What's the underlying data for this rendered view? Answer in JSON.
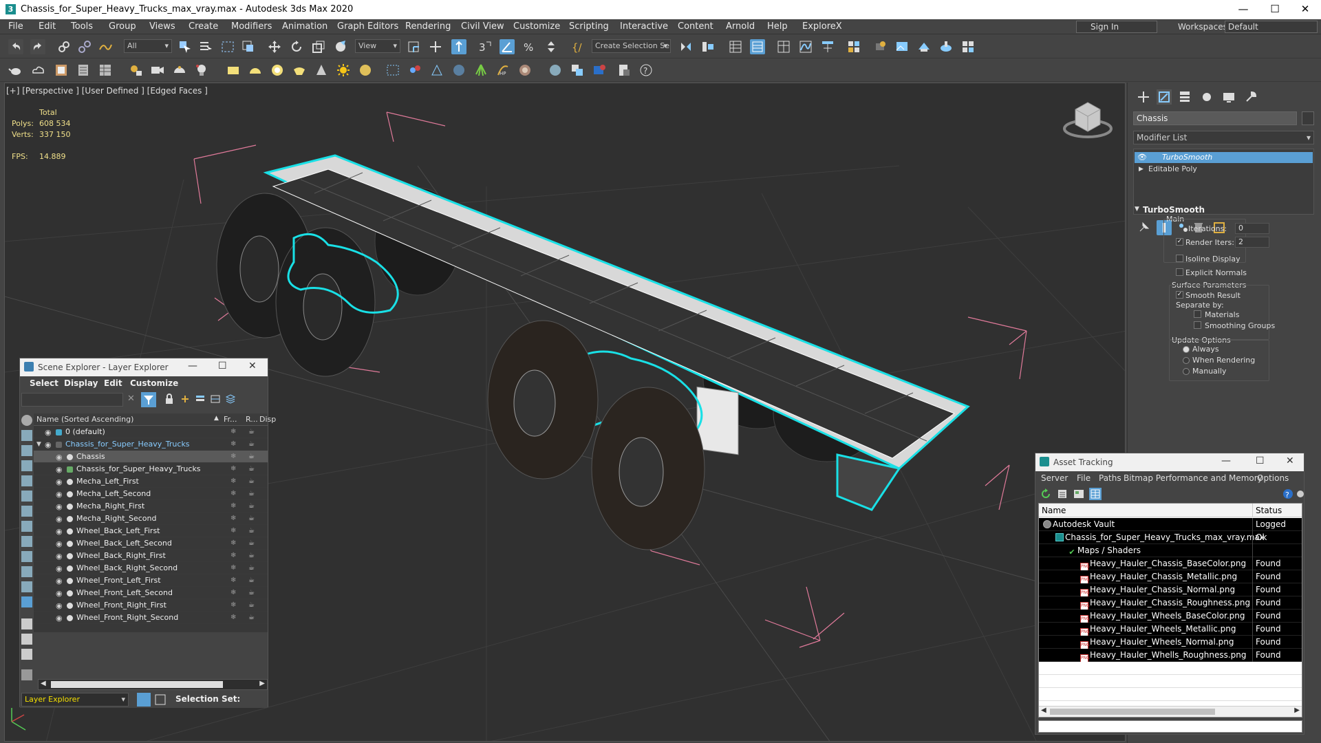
{
  "window": {
    "title": "Chassis_for_Super_Heavy_Trucks_max_vray.max - Autodesk 3ds Max 2020",
    "app_icon_letter": "3"
  },
  "menu": [
    "File",
    "Edit",
    "Tools",
    "Group",
    "Views",
    "Create",
    "Modifiers",
    "Animation",
    "Graph Editors",
    "Rendering",
    "Civil View",
    "Customize",
    "Scripting",
    "Interactive",
    "Content",
    "Arnold",
    "Help",
    "ExploreX"
  ],
  "account": {
    "sign_in": "Sign In",
    "workspaces_label": "Workspaces:",
    "workspace": "Default"
  },
  "toolbar1": {
    "filter": "All",
    "coord": "View",
    "selection_set_placeholder": "Create Selection Se"
  },
  "viewport": {
    "label": "[+] [Perspective ] [User Defined ] [Edged Faces ]",
    "stats": {
      "total_label": "Total",
      "polys_label": "Polys:",
      "polys": "608 534",
      "verts_label": "Verts:",
      "verts": "337 150",
      "fps_label": "FPS:",
      "fps": "14.889"
    }
  },
  "command_panel": {
    "object_name": "Chassis",
    "modifier_list": "Modifier List",
    "stack": [
      "TurboSmooth",
      "Editable Poly"
    ],
    "rollout": "TurboSmooth",
    "main_label": "Main",
    "iterations_label": "Iterations:",
    "iterations": "0",
    "render_iters_label": "Render Iters:",
    "render_iters": "2",
    "isoline": "Isoline Display",
    "explicit_normals": "Explicit Normals",
    "surface_params": "Surface Parameters",
    "smooth_result": "Smooth Result",
    "separate_by": "Separate by:",
    "materials": "Materials",
    "smoothing_groups": "Smoothing Groups",
    "update_options": "Update Options",
    "always": "Always",
    "when_rendering": "When Rendering",
    "manually": "Manually"
  },
  "scene_explorer": {
    "title": "Scene Explorer - Layer Explorer",
    "menu": [
      "Select",
      "Display",
      "Edit",
      "Customize"
    ],
    "columns": {
      "name": "Name (Sorted Ascending)",
      "frozen": "Fr...",
      "render": "R...",
      "display": "Disp"
    },
    "rows": [
      {
        "name": "0 (default)",
        "indent": 1,
        "type": "layer"
      },
      {
        "name": "Chassis_for_Super_Heavy_Trucks",
        "indent": 1,
        "type": "layer-active"
      },
      {
        "name": "Chassis",
        "indent": 2,
        "type": "selected"
      },
      {
        "name": "Chassis_for_Super_Heavy_Trucks",
        "indent": 2,
        "type": "group"
      },
      {
        "name": "Mecha_Left_First",
        "indent": 2,
        "type": "obj"
      },
      {
        "name": "Mecha_Left_Second",
        "indent": 2,
        "type": "obj"
      },
      {
        "name": "Mecha_Right_First",
        "indent": 2,
        "type": "obj"
      },
      {
        "name": "Mecha_Right_Second",
        "indent": 2,
        "type": "obj"
      },
      {
        "name": "Wheel_Back_Left_First",
        "indent": 2,
        "type": "obj"
      },
      {
        "name": "Wheel_Back_Left_Second",
        "indent": 2,
        "type": "obj"
      },
      {
        "name": "Wheel_Back_Right_First",
        "indent": 2,
        "type": "obj"
      },
      {
        "name": "Wheel_Back_Right_Second",
        "indent": 2,
        "type": "obj"
      },
      {
        "name": "Wheel_Front_Left_First",
        "indent": 2,
        "type": "obj"
      },
      {
        "name": "Wheel_Front_Left_Second",
        "indent": 2,
        "type": "obj"
      },
      {
        "name": "Wheel_Front_Right_First",
        "indent": 2,
        "type": "obj"
      },
      {
        "name": "Wheel_Front_Right_Second",
        "indent": 2,
        "type": "obj"
      }
    ],
    "footer": {
      "explorer": "Layer Explorer",
      "selection_set": "Selection Set:"
    }
  },
  "asset_tracking": {
    "title": "Asset Tracking",
    "menu": [
      "Server",
      "File",
      "Paths",
      "Bitmap Performance and Memory",
      "Options"
    ],
    "columns": {
      "name": "Name",
      "status": "Status"
    },
    "rows": [
      {
        "name": "Autodesk Vault",
        "status": "Logged Out",
        "indent": 0,
        "kind": "vault"
      },
      {
        "name": "Chassis_for_Super_Heavy_Trucks_max_vray.max",
        "status": "Ok",
        "indent": 1,
        "kind": "max"
      },
      {
        "name": "Maps / Shaders",
        "status": "",
        "indent": 2,
        "kind": "folder"
      },
      {
        "name": "Heavy_Hauler_Chassis_BaseColor.png",
        "status": "Found",
        "indent": 3,
        "kind": "png"
      },
      {
        "name": "Heavy_Hauler_Chassis_Metallic.png",
        "status": "Found",
        "indent": 3,
        "kind": "png"
      },
      {
        "name": "Heavy_Hauler_Chassis_Normal.png",
        "status": "Found",
        "indent": 3,
        "kind": "png"
      },
      {
        "name": "Heavy_Hauler_Chassis_Roughness.png",
        "status": "Found",
        "indent": 3,
        "kind": "png"
      },
      {
        "name": "Heavy_Hauler_Wheels_BaseColor.png",
        "status": "Found",
        "indent": 3,
        "kind": "png"
      },
      {
        "name": "Heavy_Hauler_Wheels_Metallic.png",
        "status": "Found",
        "indent": 3,
        "kind": "png"
      },
      {
        "name": "Heavy_Hauler_Wheels_Normal.png",
        "status": "Found",
        "indent": 3,
        "kind": "png"
      },
      {
        "name": "Heavy_Hauler_Whells_Roughness.png",
        "status": "Found",
        "indent": 3,
        "kind": "png"
      }
    ]
  },
  "colors": {
    "accent": "#5a9fd4",
    "selection_wire": "#19e0e6",
    "bbox": "#e07a9a",
    "stats": "#f0e08a",
    "layer_combo": "#f5e000"
  }
}
